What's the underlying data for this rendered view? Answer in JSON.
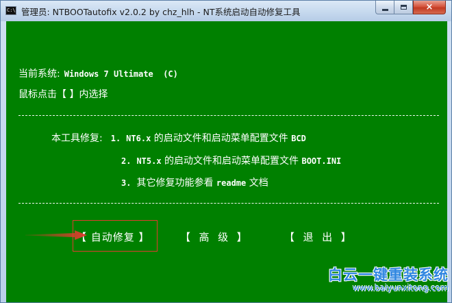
{
  "window": {
    "title": "管理员:  NTBOOTautofix v2.0.2 by chz_hlh - NT系统启动自动修复工具",
    "icon_label": "C:\\",
    "close_glyph": "×"
  },
  "console": {
    "current_system_label": "当前系统:",
    "current_system_value": "Windows 7 Ultimate  (C)",
    "hint": "鼠标点击【 】内选择",
    "repair_intro": "本工具修复:",
    "items": [
      {
        "num": "1.",
        "mono_a": "NT6.x",
        "text_a": " 的启动文件和启动菜单配置文件 ",
        "mono_b": "BCD",
        "text_b": ""
      },
      {
        "num": "2.",
        "mono_a": "NT5.x",
        "text_a": " 的启动文件和启动菜单配置文件 ",
        "mono_b": "BOOT.INI",
        "text_b": ""
      },
      {
        "num": "3.",
        "mono_a": "",
        "text_a": "其它修复功能参看 ",
        "mono_b": "readme",
        "text_b": " 文档"
      }
    ],
    "buttons": {
      "auto_repair": "【 自动修复 】",
      "advanced": "【  高  级  】",
      "exit": "【  退  出  】"
    }
  },
  "watermark": {
    "cn": "白云一键重装系统",
    "url": "www.baiyunxitong.com"
  },
  "colors": {
    "console_bg": "#008000",
    "highlight": "#e33b2f",
    "watermark": "#2f86e0"
  }
}
